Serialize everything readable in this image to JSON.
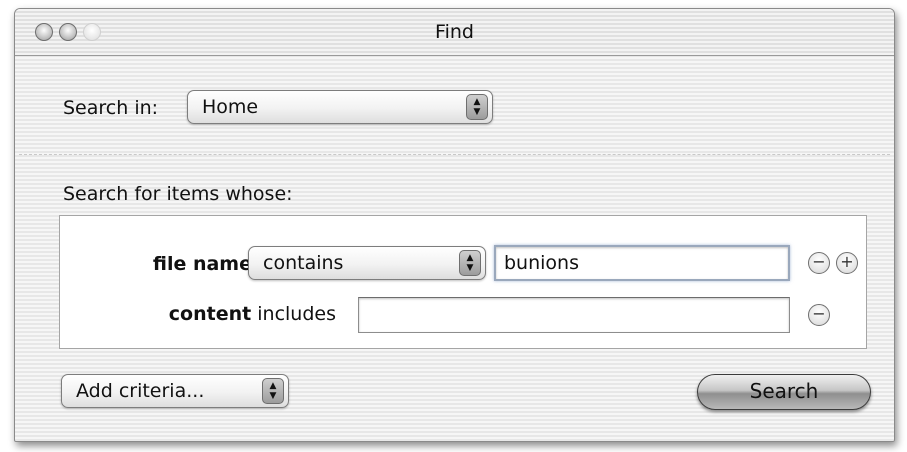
{
  "window": {
    "title": "Find"
  },
  "search_in": {
    "label": "Search in:",
    "selected": "Home"
  },
  "criteria": {
    "heading": "Search for items whose:",
    "rows": [
      {
        "field_label": "file name",
        "operator": "contains",
        "value": "bunions"
      },
      {
        "field_label": "content",
        "operator": "includes",
        "value": ""
      }
    ]
  },
  "add_criteria": {
    "selected": "Add criteria..."
  },
  "actions": {
    "search_label": "Search"
  },
  "icons": {
    "remove": "−",
    "add": "+",
    "popup_arrows": "▲▼"
  }
}
